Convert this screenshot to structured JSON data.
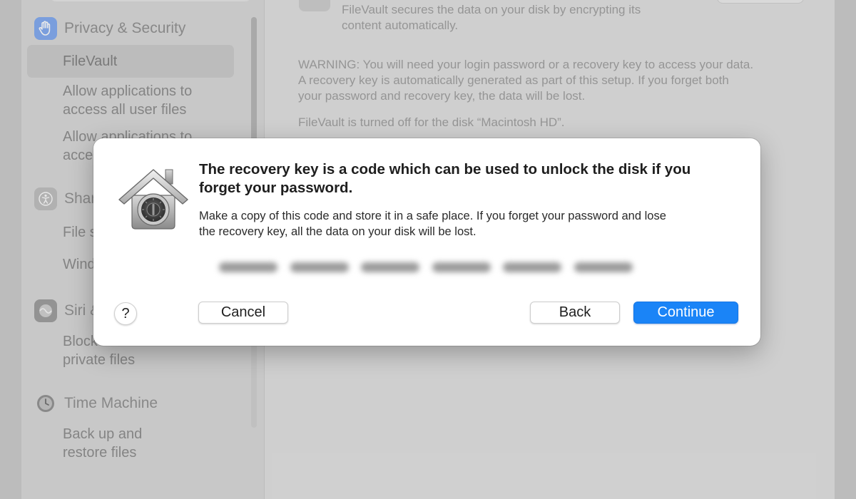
{
  "sidebar": {
    "sections": [
      {
        "title": "Privacy & Security",
        "icon": "hand-icon",
        "items": [
          {
            "label_lines": [
              "FileVault"
            ],
            "selected": true
          },
          {
            "label_lines": [
              "Allow applications to",
              "access all user files"
            ]
          },
          {
            "label_lines": [
              "Allow applications to",
              "acce"
            ]
          }
        ]
      },
      {
        "title": "Shar",
        "icon": "accessibility-icon",
        "items": [
          {
            "label_lines": [
              "File s"
            ]
          },
          {
            "label_lines": [
              "Wind"
            ]
          }
        ]
      },
      {
        "title": "Siri &",
        "icon": "siri-icon",
        "items": [
          {
            "label_lines": [
              "Block",
              "private files"
            ]
          }
        ]
      },
      {
        "title": "Time Machine",
        "icon": "time-machine-icon",
        "items": [
          {
            "label_lines": [
              "Back up and",
              "restore files"
            ]
          }
        ]
      }
    ]
  },
  "content": {
    "filevault_description": [
      "FileVault secures the data on your disk by encrypting its",
      "content automatically."
    ],
    "warning": [
      "WARNING: You will need your login password or a recovery key to access your data.",
      "A recovery key is automatically generated as part of this setup. If you forget both",
      "your password and recovery key, the data will be lost."
    ],
    "status": "FileVault is turned off for the disk “Macintosh HD”."
  },
  "dialog": {
    "title_lines": [
      "The recovery key is a code which can be used to unlock the disk if you",
      "forget your password."
    ],
    "message_lines": [
      "Make a copy of this code and store it in a safe place. If you forget your password and lose",
      "the recovery key, all the data on your disk will be lost."
    ],
    "icon": "filevault-house-safe-icon",
    "help_label": "?",
    "cancel_label": "Cancel",
    "back_label": "Back",
    "continue_label": "Continue",
    "accent_color": "#1a84f7"
  }
}
